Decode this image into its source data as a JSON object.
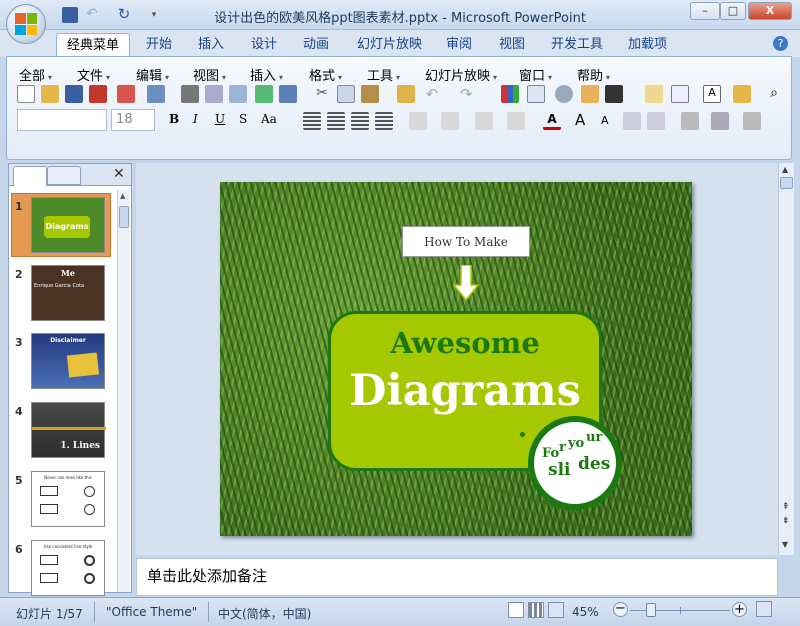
{
  "window": {
    "title": "设计出色的欧美风格ppt图表素材.pptx - Microsoft PowerPoint",
    "min": "–",
    "max": "□",
    "close": "X"
  },
  "tabs": [
    {
      "label": "经典菜单"
    },
    {
      "label": "开始"
    },
    {
      "label": "插入"
    },
    {
      "label": "设计"
    },
    {
      "label": "动画"
    },
    {
      "label": "幻灯片放映"
    },
    {
      "label": "审阅"
    },
    {
      "label": "视图"
    },
    {
      "label": "开发工具"
    },
    {
      "label": "加载项"
    }
  ],
  "menus": [
    {
      "label": "全部"
    },
    {
      "label": "文件"
    },
    {
      "label": "编辑"
    },
    {
      "label": "视图"
    },
    {
      "label": "插入"
    },
    {
      "label": "格式"
    },
    {
      "label": "工具"
    },
    {
      "label": "幻灯片放映"
    },
    {
      "label": "窗口"
    },
    {
      "label": "帮助"
    }
  ],
  "format": {
    "font": "",
    "size": "18",
    "bold": "B",
    "italic": "I",
    "underline": "U",
    "strike": "S",
    "case": "Aa",
    "grow": "A",
    "shrink": "A"
  },
  "slides": [
    {
      "num": "1",
      "title": "Diagrams"
    },
    {
      "num": "2",
      "title": "Me",
      "caption": "Enrique Garcia Cota"
    },
    {
      "num": "3",
      "title": "Disclaimer"
    },
    {
      "num": "4",
      "title": "1. Lines"
    },
    {
      "num": "5",
      "title": "Never use lines like this"
    },
    {
      "num": "6",
      "title": "Use consistent line style"
    }
  ],
  "slide": {
    "header": "How To Make",
    "line1": "Awesome",
    "line2": "Diagrams",
    "circle_a": "Fo",
    "circle_b": "r",
    "circle_c": "yo",
    "circle_d": "ur",
    "circle_e": "sli",
    "circle_f": "des"
  },
  "notes": {
    "placeholder": "单击此处添加备注"
  },
  "status": {
    "slide": "幻灯片 1/57",
    "theme": "\"Office Theme\"",
    "lang": "中文(简体，中国)",
    "zoom": "45%"
  },
  "colors": {
    "accent": "#a6c800",
    "dark_green": "#1a7a10",
    "ribbon_border": "#8db2e3"
  }
}
